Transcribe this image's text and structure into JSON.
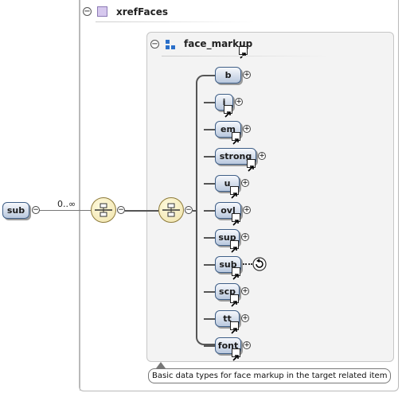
{
  "group": {
    "title": "xrefFaces"
  },
  "inner_group": {
    "title": "face_markup"
  },
  "root": {
    "label": "sub",
    "occurs": "0..∞"
  },
  "children": [
    "b",
    "i",
    "em",
    "strong",
    "u",
    "ovl",
    "sup",
    "sub",
    "scp",
    "tt",
    "font"
  ],
  "tooltip": "Basic data types for face markup in the target related item",
  "colors": {
    "element_border": "#3f5f87",
    "compositor_fill": "#efe2a8"
  }
}
